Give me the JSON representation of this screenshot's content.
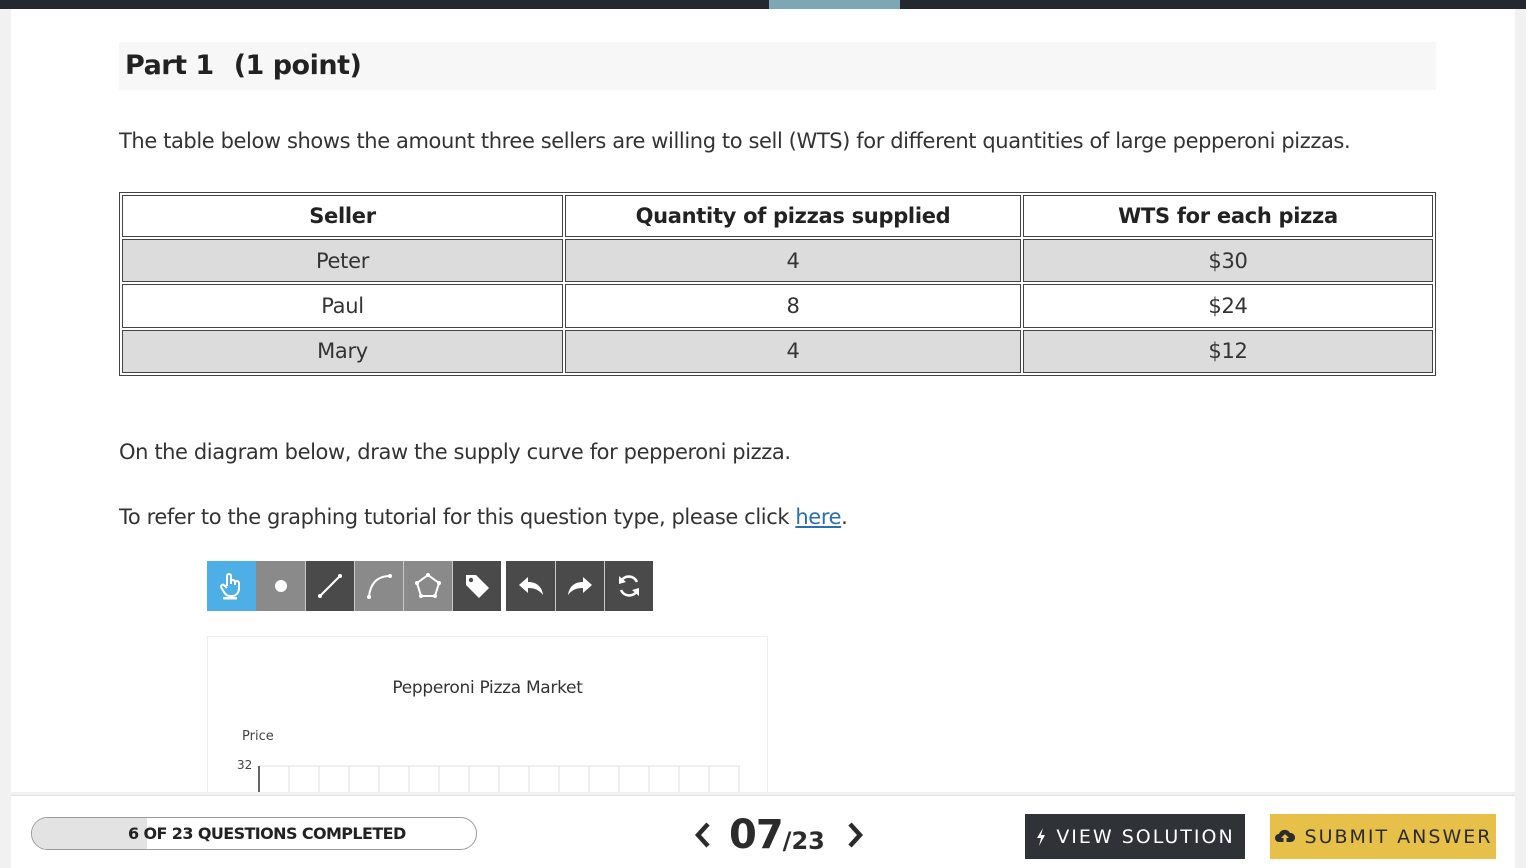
{
  "part": {
    "title": "Part 1",
    "points": "(1 point)"
  },
  "intro_text": "The table below shows the amount three sellers are willing to sell (WTS) for different quantities of large pepperoni pizzas.",
  "table": {
    "headers": [
      "Seller",
      "Quantity of pizzas supplied",
      "WTS for each pizza"
    ],
    "rows": [
      [
        "Peter",
        "4",
        "$30"
      ],
      [
        "Paul",
        "8",
        "$24"
      ],
      [
        "Mary",
        "4",
        "$12"
      ]
    ]
  },
  "instruction_text": "On the diagram below, draw the supply curve for pepperoni pizza.",
  "tutorial": {
    "text": "To refer to the graphing tutorial for this question type, please click",
    "link": "here",
    "suffix": "."
  },
  "toolbar": {
    "tools": [
      "hand-pointer-icon",
      "point-icon",
      "line-icon",
      "curve-icon",
      "polygon-icon",
      "tag-icon",
      "undo-icon",
      "redo-icon",
      "reset-icon"
    ],
    "selected": "hand-pointer-icon"
  },
  "graph": {
    "title": "Pepperoni Pizza Market",
    "y_axis_label": "Price",
    "y_top_tick": "32"
  },
  "footer": {
    "progress_text": "6 OF 23 QUESTIONS COMPLETED",
    "progress_fraction": 0.26,
    "current_page": "07",
    "total_pages": "/23",
    "view_solution": "VIEW SOLUTION",
    "submit_answer": "SUBMIT ANSWER"
  },
  "colors": {
    "tool_selected": "#4eaee6",
    "submit_button": "#e7c04a",
    "view_button": "#2f3338",
    "link": "#2a6fb0"
  }
}
